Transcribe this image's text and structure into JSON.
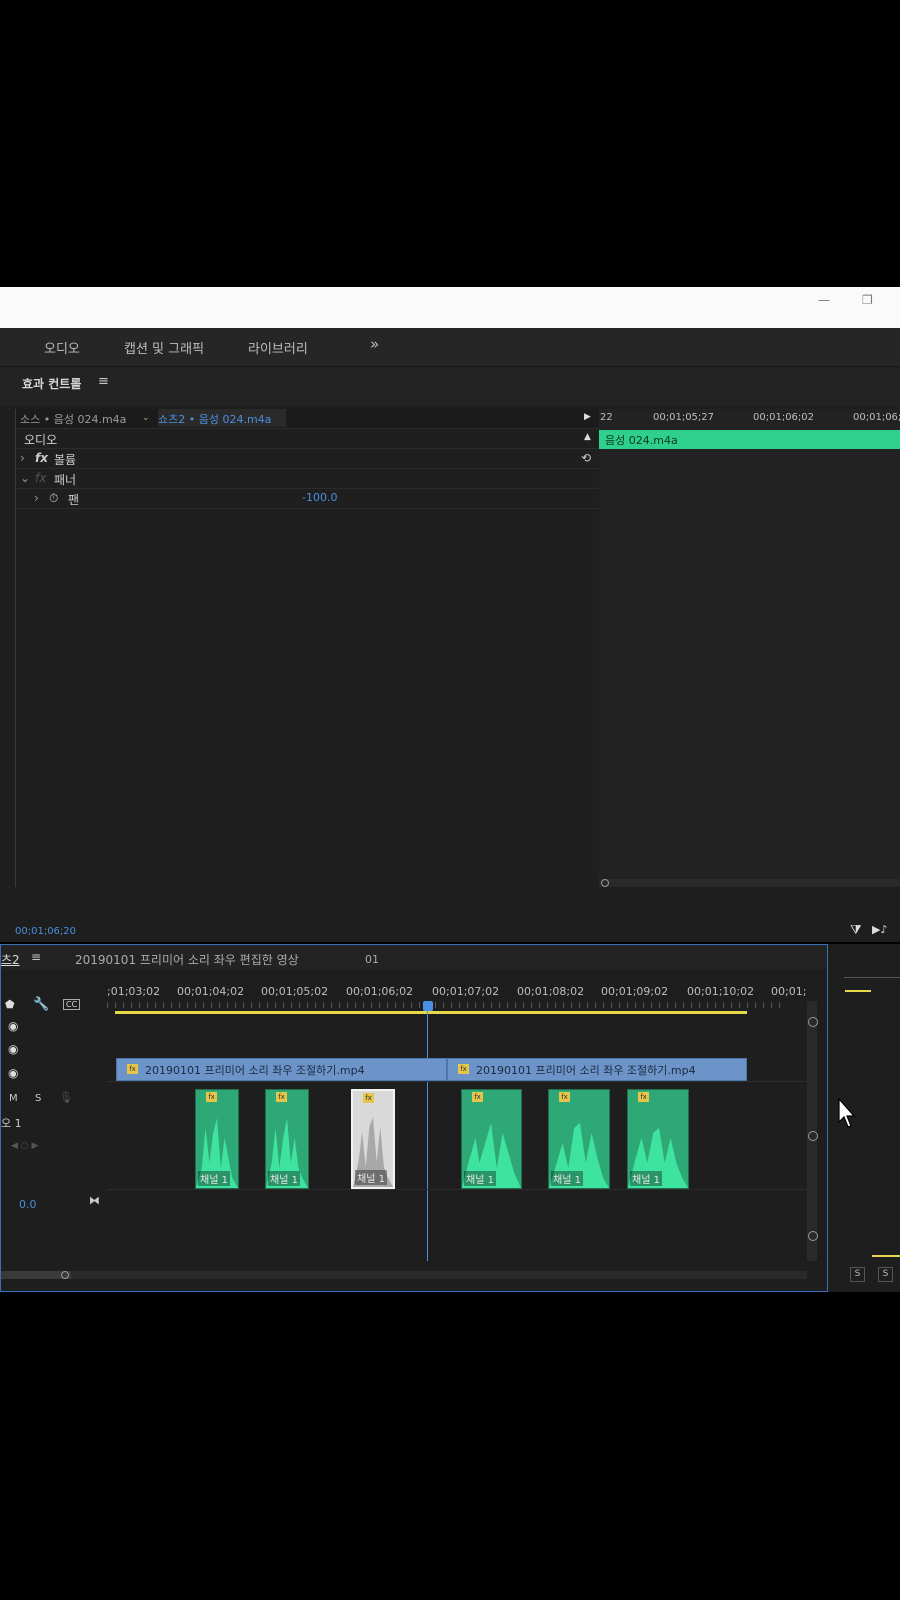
{
  "workspace": {
    "tabs": [
      "오디오",
      "캡션 및 그래픽",
      "라이브러리"
    ],
    "overflow": "»"
  },
  "effect_controls": {
    "title": "효과 컨트롤",
    "menu": "≡",
    "source_label": "소스 • 음성 024.m4a",
    "sequence_label": "쇼츠2 • 음성 024.m4a",
    "section": "오디오",
    "volume_label": "볼륨",
    "panner_label": "패너",
    "pan_label": "팬",
    "pan_value": "-100.0",
    "fx": "fx",
    "timecode": "00;01;06;20",
    "ruler": [
      "22",
      "00;01;05;27",
      "00;01;06;02",
      "00;01;06;0"
    ],
    "clip_name": "음성 024.m4a"
  },
  "timeline": {
    "seq_tab": "츠2",
    "seq_menu": "≡",
    "title": "20190101 프리미어 소리 좌우 편집한 영상",
    "extra": "01",
    "ruler": [
      ";01;03;02",
      "00;01;04;02",
      "00;01;05;02",
      "00;01;06;02",
      "00;01;07;02",
      "00;01;08;02",
      "00;01;09;02",
      "00;01;10;02",
      "00;01;"
    ],
    "video_clips": [
      {
        "name": "20190101 프리미어 소리 좌우 조절하기.mp4"
      },
      {
        "name": "20190101 프리미어 소리 좌우 조절하기.mp4"
      }
    ],
    "audio_clip_label": "채널 1",
    "audio_clip_fx": "fx",
    "track_m": "M",
    "track_s": "S",
    "track_name": "오 1",
    "track_value": "0.0",
    "cc": "CC"
  },
  "meter": {
    "solo_left": "S",
    "solo_right": "S"
  },
  "window": {
    "minimize": "—",
    "restore": "❐"
  },
  "colors": {
    "accent_blue": "#3a6fb5",
    "audio_green": "#2fcf8e",
    "video_blue": "#6d94c8",
    "playhead": "#4a90e2"
  }
}
